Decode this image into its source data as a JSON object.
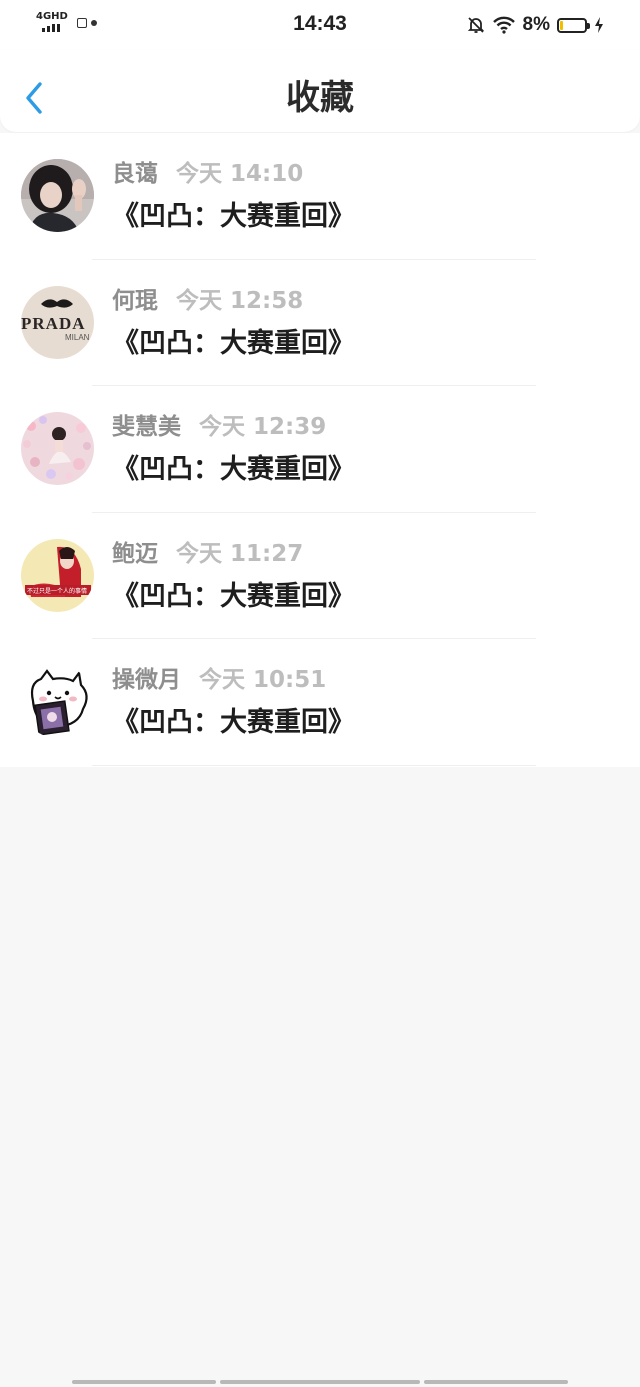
{
  "status_bar": {
    "network": "4GHD",
    "time": "14:43",
    "battery": "8%",
    "battery_level": 0.08,
    "icons": [
      "signal-icon",
      "screen-record-icon",
      "mute-bell-icon",
      "wifi-icon",
      "battery-icon",
      "charging-icon"
    ]
  },
  "nav": {
    "title": "收藏",
    "back_icon": "chevron-left-icon",
    "accent_color": "#2d9be6"
  },
  "favorites": [
    {
      "user": "良蔼",
      "time": "今天 14:10",
      "title": "《凹凸：大赛重回》",
      "avatar": "photo-girl-waving"
    },
    {
      "user": "何琨",
      "time": "今天 12:58",
      "title": "《凹凸：大赛重回》",
      "avatar": "prada-logo",
      "avatar_text": "PRADA",
      "avatar_subtext": "MILAN"
    },
    {
      "user": "斐慧美",
      "time": "今天 12:39",
      "title": "《凹凸：大赛重回》",
      "avatar": "pink-balls-girl"
    },
    {
      "user": "鲍迈",
      "time": "今天 11:27",
      "title": "《凹凸：大赛重回》",
      "avatar": "red-girl-yellow",
      "avatar_text": "不过只是一个人的事情"
    },
    {
      "user": "操微月",
      "time": "今天 10:51",
      "title": "《凹凸：大赛重回》",
      "avatar": "cartoon-cat"
    }
  ]
}
